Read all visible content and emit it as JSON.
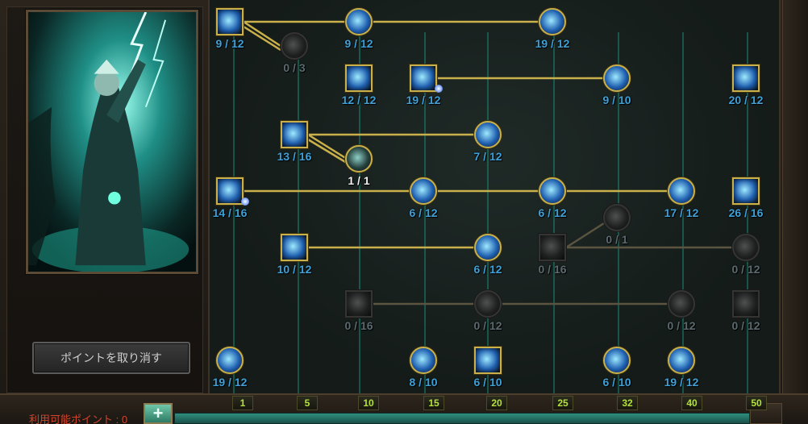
{
  "undo_button": {
    "label": "ポイントを取り消す"
  },
  "available_points": {
    "label": "利用可能ポイント : 0"
  },
  "level_ticks": [
    "1",
    "5",
    "10",
    "15",
    "20",
    "25",
    "32",
    "40",
    "50"
  ],
  "accent": {
    "gold": "#c9b04a",
    "blue_count": "#3fa0d8",
    "tick_text": "#b3e23c",
    "points_text": "#d4432c"
  },
  "skills": [
    {
      "id": "s1",
      "icon": "ice-spear-icon",
      "count": "9 / 12",
      "shape": "square",
      "state": "active"
    },
    {
      "id": "s2",
      "icon": "rune-shield-icon",
      "count": "0 / 3",
      "shape": "round",
      "state": "locked"
    },
    {
      "id": "s3",
      "icon": "arcane-bolt-icon",
      "count": "9 / 12",
      "shape": "round",
      "state": "active"
    },
    {
      "id": "s4",
      "icon": "fire-orb-icon",
      "count": "19 / 12",
      "shape": "round",
      "state": "active"
    },
    {
      "id": "s5",
      "icon": "lightning-strike-icon",
      "count": "12 / 12",
      "shape": "square",
      "state": "active"
    },
    {
      "id": "s6",
      "icon": "spirit-summon-icon",
      "count": "19 / 12",
      "shape": "square",
      "state": "active"
    },
    {
      "id": "s7",
      "icon": "green-vortex-icon",
      "count": "9 / 10",
      "shape": "round",
      "state": "active"
    },
    {
      "id": "s8",
      "icon": "armored-knight-icon",
      "count": "20 / 12",
      "shape": "square",
      "state": "active"
    },
    {
      "id": "s9",
      "icon": "violet-burst-icon",
      "count": "13 / 16",
      "shape": "square",
      "state": "active"
    },
    {
      "id": "s10",
      "icon": "rune-shield-icon",
      "count": "1 / 1",
      "shape": "round",
      "state": "white"
    },
    {
      "id": "s11",
      "icon": "flame-burst-icon",
      "count": "7 / 12",
      "shape": "round",
      "state": "active"
    },
    {
      "id": "s12",
      "icon": "violet-beam-icon",
      "count": "14 / 16",
      "shape": "square",
      "state": "active"
    },
    {
      "id": "s13",
      "icon": "violet-slash-icon",
      "count": "6 / 12",
      "shape": "round",
      "state": "active"
    },
    {
      "id": "s14",
      "icon": "blue-blade-icon",
      "count": "6 / 12",
      "shape": "round",
      "state": "active"
    },
    {
      "id": "s15",
      "icon": "frost-nova-icon",
      "count": "17 / 12",
      "shape": "round",
      "state": "active"
    },
    {
      "id": "s16",
      "icon": "ice-shards-icon",
      "count": "26 / 16",
      "shape": "square",
      "state": "active"
    },
    {
      "id": "s17",
      "icon": "rune-shield-icon",
      "count": "0 / 1",
      "shape": "round",
      "state": "locked"
    },
    {
      "id": "s18",
      "icon": "mana-surge-icon",
      "count": "10 / 12",
      "shape": "square",
      "state": "active"
    },
    {
      "id": "s19",
      "icon": "snowflake-icon",
      "count": "6 / 12",
      "shape": "round",
      "state": "active"
    },
    {
      "id": "s20",
      "icon": "claw-strike-icon",
      "count": "0 / 16",
      "shape": "square",
      "state": "locked"
    },
    {
      "id": "s21",
      "icon": "skull-icon",
      "count": "0 / 12",
      "shape": "round",
      "state": "locked"
    },
    {
      "id": "s22",
      "icon": "wind-slash-icon",
      "count": "0 / 16",
      "shape": "square",
      "state": "locked"
    },
    {
      "id": "s23",
      "icon": "shadow-orb-icon",
      "count": "0 / 12",
      "shape": "round",
      "state": "locked"
    },
    {
      "id": "s24",
      "icon": "storm-cut-icon",
      "count": "0 / 12",
      "shape": "round",
      "state": "locked"
    },
    {
      "id": "s25",
      "icon": "frozen-soul-icon",
      "count": "0 / 12",
      "shape": "square",
      "state": "locked"
    },
    {
      "id": "s26",
      "icon": "meditation-icon",
      "count": "19 / 12",
      "shape": "round",
      "state": "active"
    },
    {
      "id": "s27",
      "icon": "fist-icon",
      "count": "8 / 10",
      "shape": "round",
      "state": "active"
    },
    {
      "id": "s28",
      "icon": "blue-portal-icon",
      "count": "6 / 10",
      "shape": "square",
      "state": "active"
    },
    {
      "id": "s29",
      "icon": "dragon-scale-icon",
      "count": "6 / 10",
      "shape": "round",
      "state": "active"
    },
    {
      "id": "s30",
      "icon": "spell-tome-icon",
      "count": "19 / 12",
      "shape": "round",
      "state": "active"
    }
  ]
}
